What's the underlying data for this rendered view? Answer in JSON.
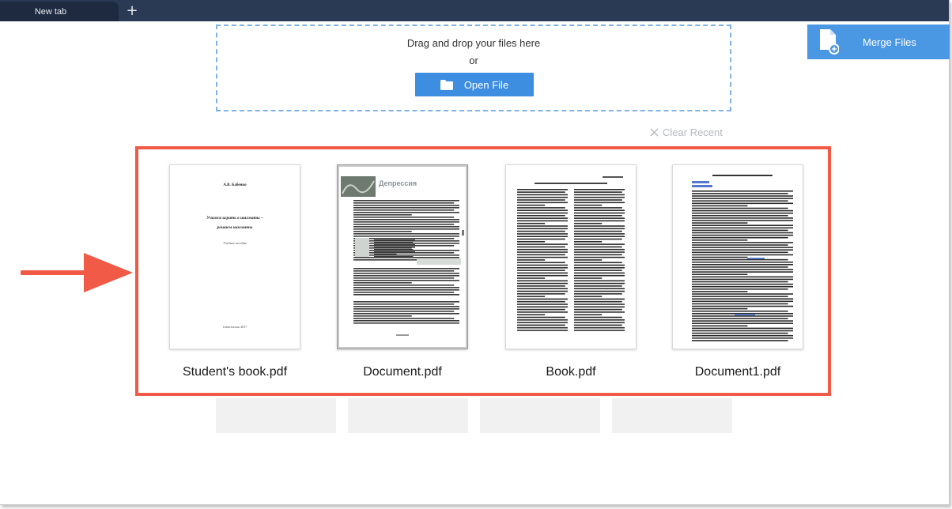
{
  "tabs": {
    "active_label": "New tab",
    "add_icon": "plus-icon"
  },
  "dropzone": {
    "prompt": "Drag and drop your files here",
    "or_text": "or",
    "open_label": "Open File",
    "open_icon": "folder-icon"
  },
  "merge": {
    "label": "Merge Files",
    "icon": "document-add-icon"
  },
  "recent": {
    "clear_label": "Clear Recent",
    "clear_icon": "close-icon",
    "files": [
      {
        "name": "Student's book.pdf"
      },
      {
        "name": "Document.pdf"
      },
      {
        "name": "Book.pdf"
      },
      {
        "name": "Document1.pdf"
      }
    ]
  },
  "thumbnails": {
    "doc1": {
      "author": "А.В. Бабенко",
      "title_line1": "Учимся играть в шахматы –",
      "title_line2": "решаем шахматы",
      "subtitle": "Учебное пособие",
      "footer": "Севастополь 2017"
    },
    "doc2": {
      "heading": "Депрессия"
    }
  },
  "colors": {
    "accent": "#3d8ee0",
    "highlight": "#f05a46",
    "tabbar": "#2a3a54",
    "dashed": "#7fb2e6"
  }
}
